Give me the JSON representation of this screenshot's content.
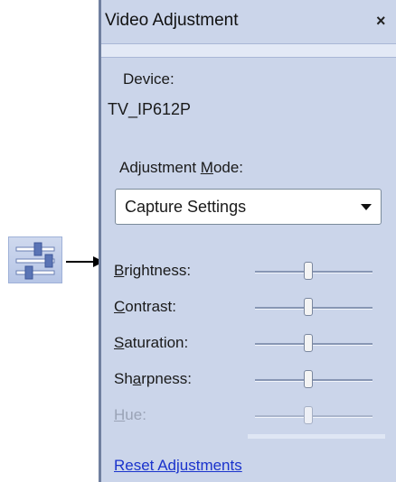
{
  "panel": {
    "title": "Video Adjustment",
    "close_glyph": "×",
    "device_label": "Device:",
    "device_value": "TV_IP612P",
    "mode_label_pre": "Adjustment ",
    "mode_label_key": "M",
    "mode_label_post": "ode:",
    "mode_value": "Capture Settings",
    "reset_label": "Reset Adjustments"
  },
  "sliders": [
    {
      "key": "B",
      "rest": "rightness:",
      "level_pct": 45,
      "enabled": true
    },
    {
      "key": "C",
      "rest": "ontrast:",
      "level_pct": 45,
      "enabled": true
    },
    {
      "key": "S",
      "rest": "aturation:",
      "level_pct": 45,
      "enabled": true
    },
    {
      "key_pre": "Sh",
      "key": "a",
      "rest": "rpness:",
      "level_pct": 45,
      "enabled": true
    },
    {
      "key": "H",
      "rest": "ue:",
      "level_pct": 45,
      "enabled": false
    }
  ],
  "icons": {
    "tool": "sliders-tool-icon",
    "arrow": "arrow-right-icon",
    "dropdown": "chevron-down-icon"
  },
  "colors": {
    "panel_bg": "#cbd5ea",
    "link": "#1a33cc",
    "disabled_text": "#9aa3b6"
  }
}
